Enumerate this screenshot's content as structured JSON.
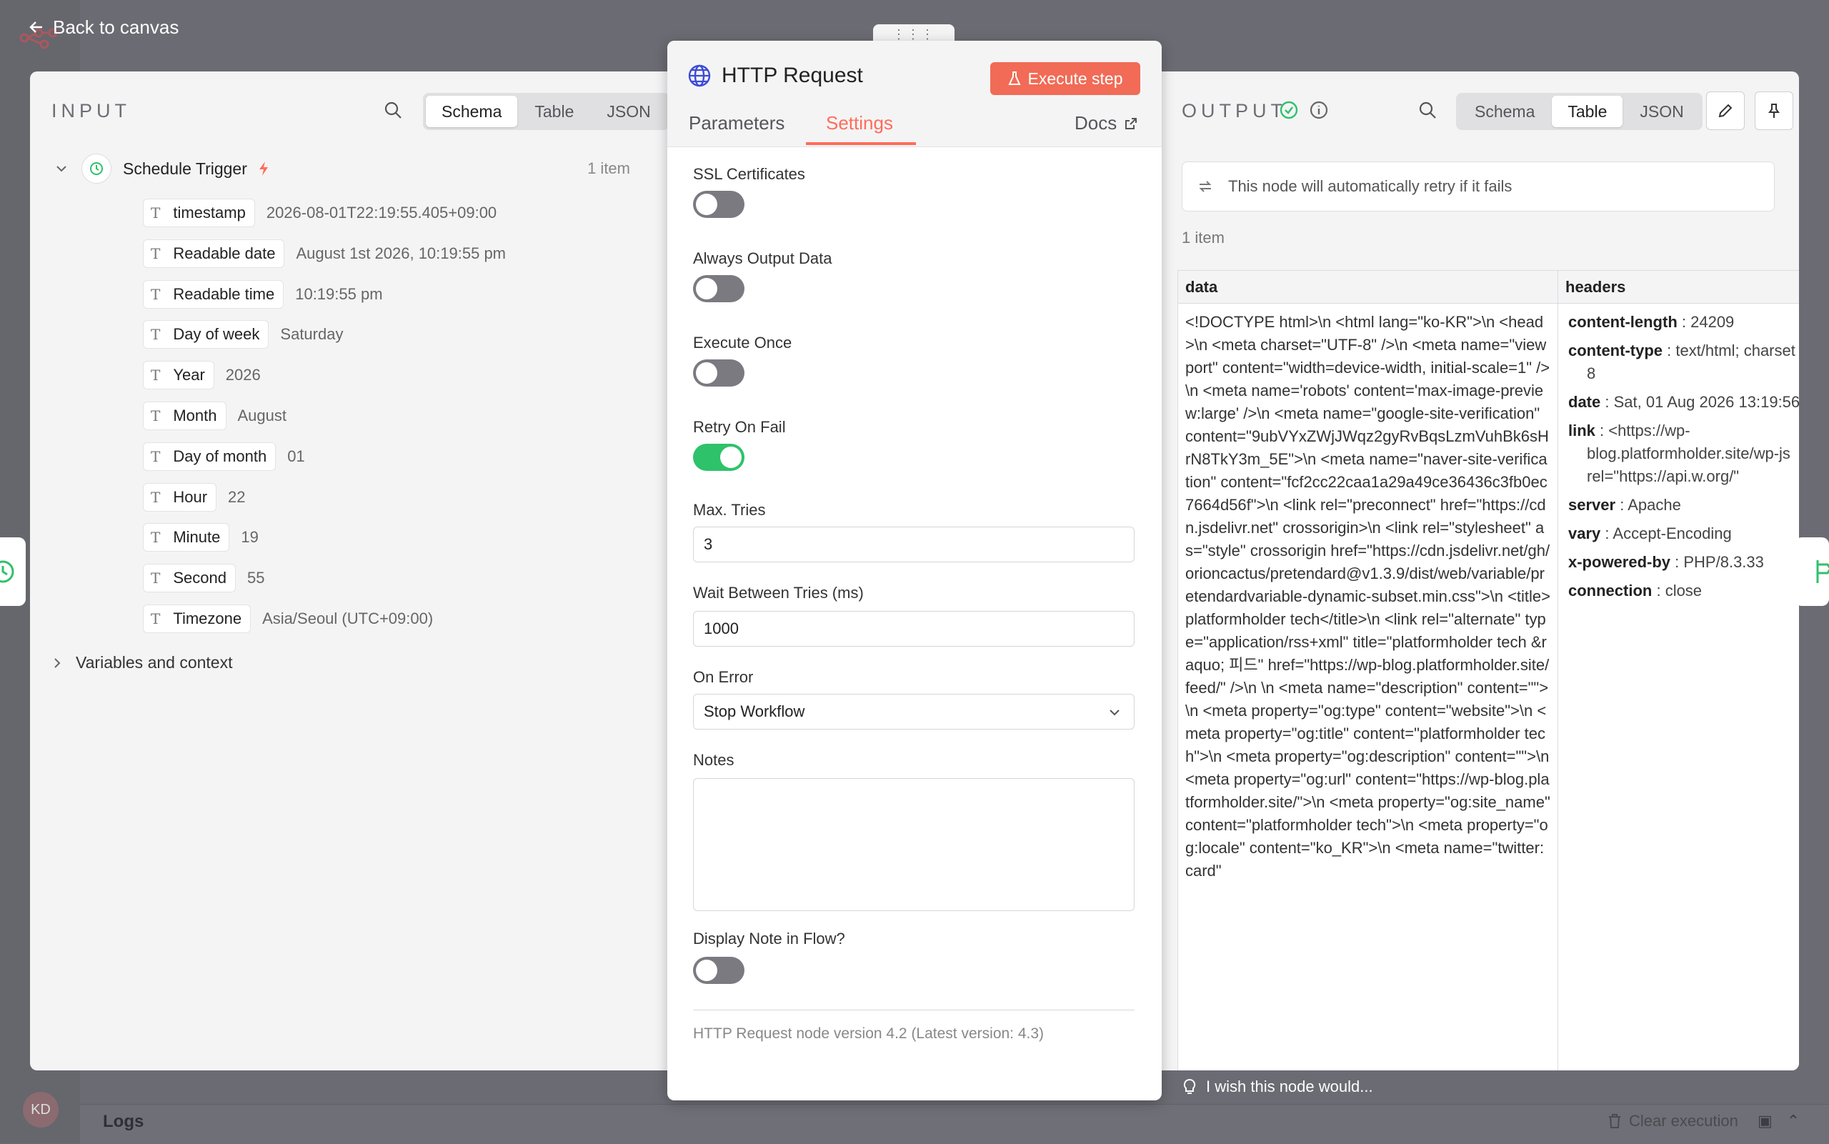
{
  "topbar": {
    "back_label": "Back to canvas"
  },
  "user": {
    "initials": "KD"
  },
  "logs": {
    "label": "Logs",
    "clear_label": "Clear execution"
  },
  "input": {
    "title": "INPUT",
    "view_tabs": [
      "Schema",
      "Table",
      "JSON"
    ],
    "active_tab": "Schema",
    "node": {
      "name": "Schedule Trigger",
      "count": "1 item"
    },
    "fields": [
      {
        "type": "T",
        "name": "timestamp",
        "value": "2026-08-01T22:19:55.405+09:00"
      },
      {
        "type": "T",
        "name": "Readable date",
        "value": "August 1st 2026, 10:19:55 pm"
      },
      {
        "type": "T",
        "name": "Readable time",
        "value": "10:19:55 pm"
      },
      {
        "type": "T",
        "name": "Day of week",
        "value": "Saturday"
      },
      {
        "type": "T",
        "name": "Year",
        "value": "2026"
      },
      {
        "type": "T",
        "name": "Month",
        "value": "August"
      },
      {
        "type": "T",
        "name": "Day of month",
        "value": "01"
      },
      {
        "type": "T",
        "name": "Hour",
        "value": "22"
      },
      {
        "type": "T",
        "name": "Minute",
        "value": "19"
      },
      {
        "type": "T",
        "name": "Second",
        "value": "55"
      },
      {
        "type": "T",
        "name": "Timezone",
        "value": "Asia/Seoul (UTC+09:00)"
      }
    ],
    "variables_label": "Variables and context"
  },
  "node_panel": {
    "title": "HTTP Request",
    "execute_label": "Execute step",
    "tabs": {
      "parameters": "Parameters",
      "settings": "Settings",
      "docs": "Docs"
    },
    "active_tab": "Settings",
    "settings": {
      "ssl_label": "SSL Certificates",
      "ssl_on": false,
      "always_output_label": "Always Output Data",
      "always_output_on": false,
      "execute_once_label": "Execute Once",
      "execute_once_on": false,
      "retry_label": "Retry On Fail",
      "retry_on": true,
      "max_tries_label": "Max. Tries",
      "max_tries_value": "3",
      "wait_label": "Wait Between Tries (ms)",
      "wait_value": "1000",
      "on_error_label": "On Error",
      "on_error_value": "Stop Workflow",
      "notes_label": "Notes",
      "notes_value": "",
      "display_note_label": "Display Note in Flow?",
      "display_note_on": false
    },
    "version_note": "HTTP Request node version 4.2 (Latest version: 4.3)"
  },
  "output": {
    "title": "OUTPUT",
    "view_tabs": [
      "Schema",
      "Table",
      "JSON"
    ],
    "active_tab": "Table",
    "retry_notice": "This node will automatically retry if it fails",
    "count": "1 item",
    "columns": [
      "data",
      "headers"
    ],
    "data_text": "<!DOCTYPE html>\\n <html lang=\"ko-KR\">\\n <head>\\n         <meta charset=\"UTF-8\" />\\n         <meta name=\"viewport\" content=\"width=device-width, initial-scale=1\" />\\n <meta name='robots' content='max-image-preview:large' />\\n <meta name=\"google-site-verification\" content=\"9ubVYxZWjJWqz2gyRvBqsLzmVuhBk6sHrN8TkY3m_5E\">\\n <meta name=\"naver-site-verification\" content=\"fcf2cc22caa1a29a49ce36436c3fb0ec7664d56f\">\\n <link rel=\"preconnect\" href=\"https://cdn.jsdelivr.net\" crossorigin>\\n <link rel=\"stylesheet\" as=\"style\" crossorigin href=\"https://cdn.jsdelivr.net/gh/orioncactus/pretendard@v1.3.9/dist/web/variable/pretendardvariable-dynamic-subset.min.css\">\\n <title>platformholder tech</title>\\n <link rel=\"alternate\" type=\"application/rss+xml\" title=\"platformholder tech &raquo; 피드\" href=\"https://wp-blog.platformholder.site/feed/\" />\\n \\n <meta name=\"description\" content=\"\">\\n <meta property=\"og:type\" content=\"website\">\\n <meta property=\"og:title\" content=\"platformholder tech\">\\n <meta property=\"og:description\" content=\"\">\\n <meta property=\"og:url\" content=\"https://wp-blog.platformholder.site/\">\\n <meta property=\"og:site_name\" content=\"platformholder tech\">\\n <meta property=\"og:locale\" content=\"ko_KR\">\\n <meta name=\"twitter:card\"",
    "headers": [
      {
        "key": "content-length",
        "value": "24209"
      },
      {
        "key": "content-type",
        "value": "text/html; charset",
        "wrap": "8"
      },
      {
        "key": "date",
        "value": "Sat, 01 Aug 2026 13:19:56"
      },
      {
        "key": "link",
        "value": "<https://wp-",
        "wrap": "blog.platformholder.site/wp-js",
        "wrap2": "rel=\"https://api.w.org/\""
      },
      {
        "key": "server",
        "value": "Apache"
      },
      {
        "key": "vary",
        "value": "Accept-Encoding"
      },
      {
        "key": "x-powered-by",
        "value": "PHP/8.3.33"
      },
      {
        "key": "connection",
        "value": "close"
      }
    ]
  },
  "feedback": {
    "label": "I wish this node would..."
  },
  "colors": {
    "accent": "#ff6d5a",
    "toggle_on": "#2ec26a",
    "success": "#2ec26a"
  }
}
